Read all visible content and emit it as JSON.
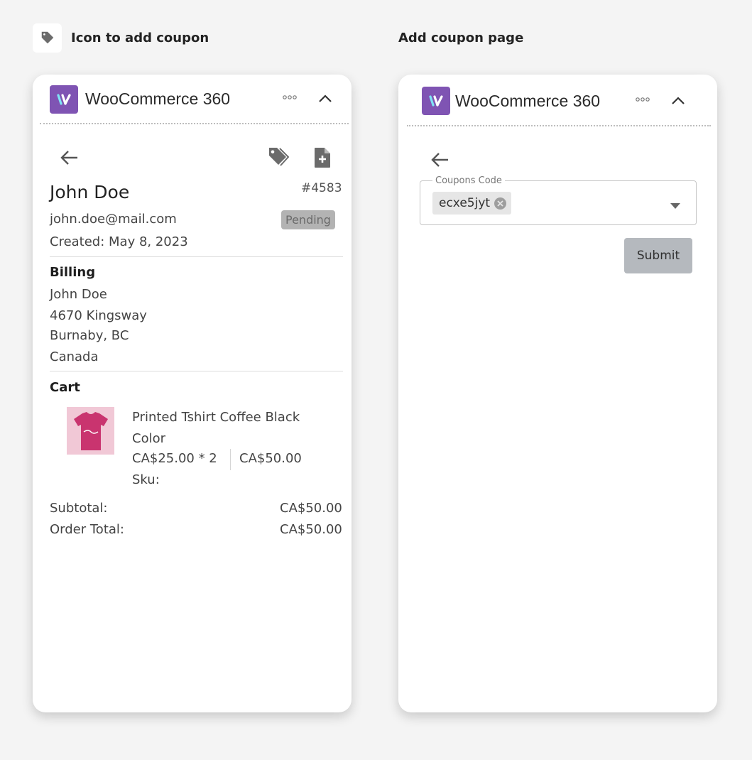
{
  "captions": {
    "left": "Icon to add coupon",
    "right": "Add coupon page"
  },
  "app": {
    "title": "WooCommerce 360",
    "brand_color": "#7f54b3"
  },
  "order": {
    "customer_name": "John Doe",
    "order_number": "#4583",
    "email": "john.doe@mail.com",
    "status": "Pending",
    "created": "Created: May 8, 2023",
    "billing_title": "Billing",
    "billing_lines": [
      "John Doe",
      "4670 Kingsway",
      "Burnaby, BC",
      "Canada"
    ],
    "cart_title": "Cart",
    "item": {
      "name_line1": "Printed Tshirt Coffee Black",
      "name_line2": "Color",
      "price_qty": "CA$25.00 * 2",
      "line_total": "CA$50.00",
      "sku": "Sku:"
    },
    "subtotal_label": "Subtotal:",
    "subtotal_value": "CA$50.00",
    "total_label": "Order Total:",
    "total_value": "CA$50.00"
  },
  "coupon": {
    "field_label": "Coupons Code",
    "chip_value": "ecxe5jyt",
    "submit_label": "Submit"
  },
  "icons": {
    "caption_icon": "tag-icon",
    "back": "arrow-left-icon",
    "coupon": "tags-icon",
    "note": "file-plus-icon",
    "more": "more-dots-icon",
    "collapse": "chevron-up-icon",
    "dropdown": "caret-down-icon",
    "chip_remove": "close-circle-icon"
  }
}
